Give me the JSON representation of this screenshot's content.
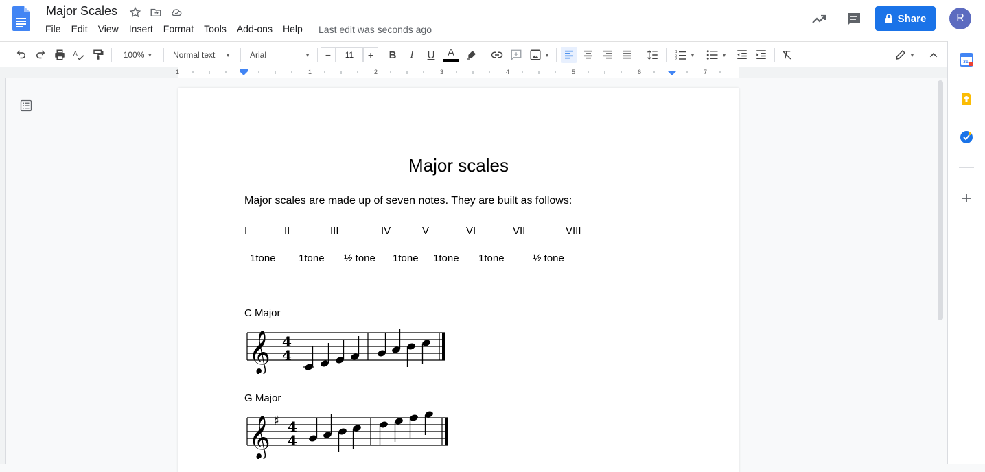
{
  "header": {
    "title": "Major Scales",
    "menu": [
      "File",
      "Edit",
      "View",
      "Insert",
      "Format",
      "Tools",
      "Add-ons",
      "Help"
    ],
    "last_edit": "Last edit was seconds ago",
    "share_label": "Share",
    "avatar_initial": "R"
  },
  "toolbar": {
    "zoom": "100%",
    "style": "Normal text",
    "font": "Arial",
    "font_size": "11"
  },
  "ruler": [
    "1",
    "1",
    "2",
    "3",
    "4",
    "5",
    "6",
    "7"
  ],
  "document": {
    "title": "Major scales",
    "intro": "Major scales are made up of seven notes. They are built as follows:",
    "degrees": [
      "I",
      "II",
      "III",
      "IV",
      "V",
      "VI",
      "VII",
      "VIII"
    ],
    "intervals": [
      "1tone",
      "1tone",
      "½ tone",
      "1tone",
      "1tone",
      "1tone",
      "½ tone"
    ],
    "scales": [
      {
        "label": "C Major"
      },
      {
        "label": "G Major"
      }
    ]
  },
  "colors": {
    "accent": "#1a73e8",
    "avatar": "#5c6bc0"
  }
}
